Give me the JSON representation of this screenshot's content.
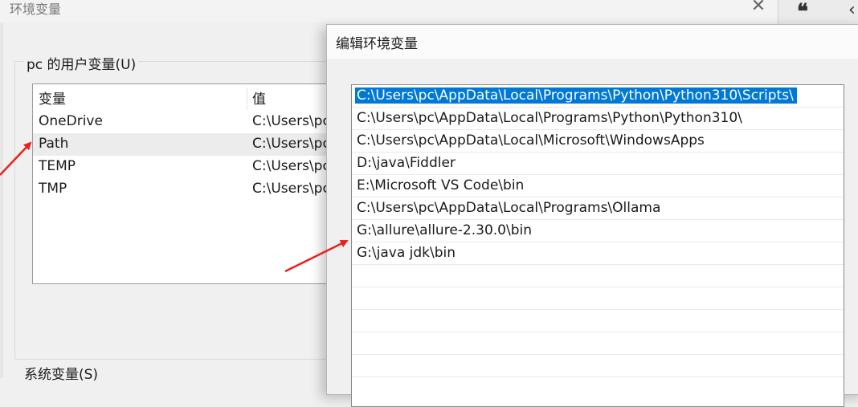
{
  "background_window": {
    "title": "环境变量",
    "close_glyph": "✕",
    "user_group": {
      "label": "pc 的用户变量(U)",
      "columns": [
        "变量",
        "值"
      ],
      "rows": [
        {
          "name": "OneDrive",
          "value": "C:\\Users\\pc"
        },
        {
          "name": "Path",
          "value": "C:\\Users\\pc"
        },
        {
          "name": "TEMP",
          "value": "C:\\Users\\pc"
        },
        {
          "name": "TMP",
          "value": "C:\\Users\\pc"
        }
      ],
      "selected_row": "Path"
    },
    "system_group": {
      "label": "系统变量(S)"
    }
  },
  "right_strip": {
    "quote_glyph": "❝",
    "chevron_glyph": "‹"
  },
  "edit_dialog": {
    "title": "编辑环境变量",
    "entries": [
      "C:\\Users\\pc\\AppData\\Local\\Programs\\Python\\Python310\\Scripts\\",
      "C:\\Users\\pc\\AppData\\Local\\Programs\\Python\\Python310\\",
      "C:\\Users\\pc\\AppData\\Local\\Microsoft\\WindowsApps",
      "D:\\java\\Fiddler",
      "E:\\Microsoft VS Code\\bin",
      "C:\\Users\\pc\\AppData\\Local\\Programs\\Ollama",
      "G:\\allure\\allure-2.30.0\\bin",
      "G:\\java jdk\\bin"
    ],
    "selected_index": 0
  },
  "colors": {
    "selection_blue": "#0078d7",
    "annotation_red": "#e8231f"
  }
}
